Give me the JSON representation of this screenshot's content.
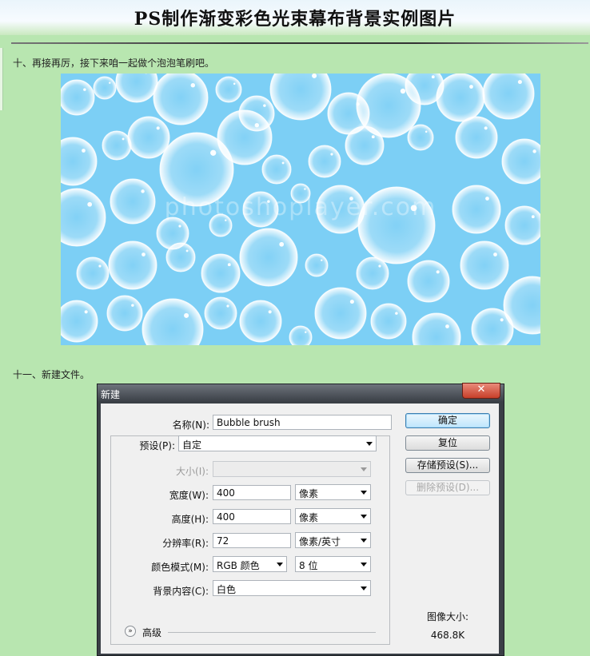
{
  "page": {
    "title": "PS制作渐变彩色光束幕布背景实例图片",
    "step10": "十、再接再厉，接下来咱一起做个泡泡笔刷吧。",
    "step11": "十一、新建文件。",
    "watermark": "photoshoplayer.com"
  },
  "colors": {
    "page_background": "#b8e6b0",
    "bubble_background": "#7ccff5",
    "dialog_frame": "#3a3f46",
    "close_button": "#c7402a"
  },
  "dialog": {
    "title": "新建",
    "close_glyph": "✕",
    "name_label": "名称(N):",
    "name_value": "Bubble brush",
    "preset_label": "预设(P):",
    "preset_value": "自定",
    "size_label": "大小(I):",
    "size_value": "",
    "width_label": "宽度(W):",
    "width_value": "400",
    "width_unit": "像素",
    "height_label": "高度(H):",
    "height_value": "400",
    "height_unit": "像素",
    "resolution_label": "分辨率(R):",
    "resolution_value": "72",
    "resolution_unit": "像素/英寸",
    "color_mode_label": "颜色模式(M):",
    "color_mode_value": "RGB 颜色",
    "bit_depth_value": "8 位",
    "background_label": "背景内容(C):",
    "background_value": "白色",
    "advanced_label": "高级",
    "buttons": {
      "ok": "确定",
      "reset": "复位",
      "save_preset": "存储预设(S)...",
      "delete_preset": "删除预设(D)..."
    },
    "image_size_label": "图像大小:",
    "image_size_value": "468.8K"
  }
}
